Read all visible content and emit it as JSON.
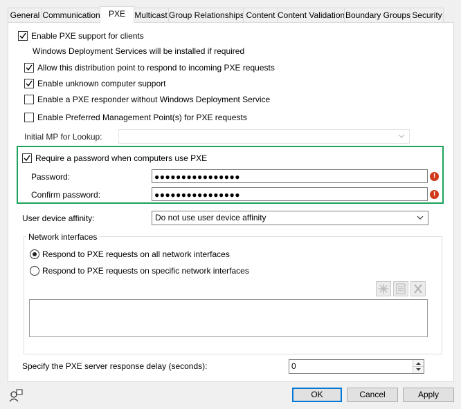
{
  "tabs": [
    {
      "label": "General"
    },
    {
      "label": "Communication"
    },
    {
      "label": "PXE"
    },
    {
      "label": "Multicast"
    },
    {
      "label": "Group Relationships"
    },
    {
      "label": "Content"
    },
    {
      "label": "Content Validation"
    },
    {
      "label": "Boundary Groups"
    },
    {
      "label": "Security"
    }
  ],
  "pxe": {
    "enable_label": "Enable PXE support for clients",
    "wds_note": "Windows Deployment Services will be installed if required",
    "allow_respond_label": "Allow this distribution point to respond to incoming PXE requests",
    "unknown_label": "Enable unknown computer support",
    "responder_label": "Enable a PXE responder without Windows Deployment Service",
    "preferred_mp_label": "Enable Preferred Management Point(s) for PXE requests",
    "initial_mp_label": "Initial MP for Lookup:",
    "initial_mp_value": "",
    "require_password_label": "Require a password when computers use PXE",
    "password_label": "Password:",
    "password_value": "●●●●●●●●●●●●●●●●",
    "confirm_label": "Confirm password:",
    "confirm_value": "●●●●●●●●●●●●●●●●",
    "error_glyph": "!",
    "affinity_label": "User device affinity:",
    "affinity_value": "Do not use user device affinity",
    "network_group_label": "Network interfaces",
    "radio_all_label": "Respond to PXE requests on all network interfaces",
    "radio_specific_label": "Respond to PXE requests on specific network interfaces",
    "delay_label": "Specify the PXE server response delay (seconds):",
    "delay_value": "0"
  },
  "checkbox_states": {
    "enable": true,
    "allow_respond": true,
    "unknown": true,
    "responder": false,
    "preferred_mp": false,
    "require_password": true
  },
  "footer": {
    "ok": "OK",
    "cancel": "Cancel",
    "apply": "Apply"
  },
  "colors": {
    "highlight_border": "#1aa35a",
    "primary_border": "#0078d7",
    "error": "#d03a1a"
  }
}
